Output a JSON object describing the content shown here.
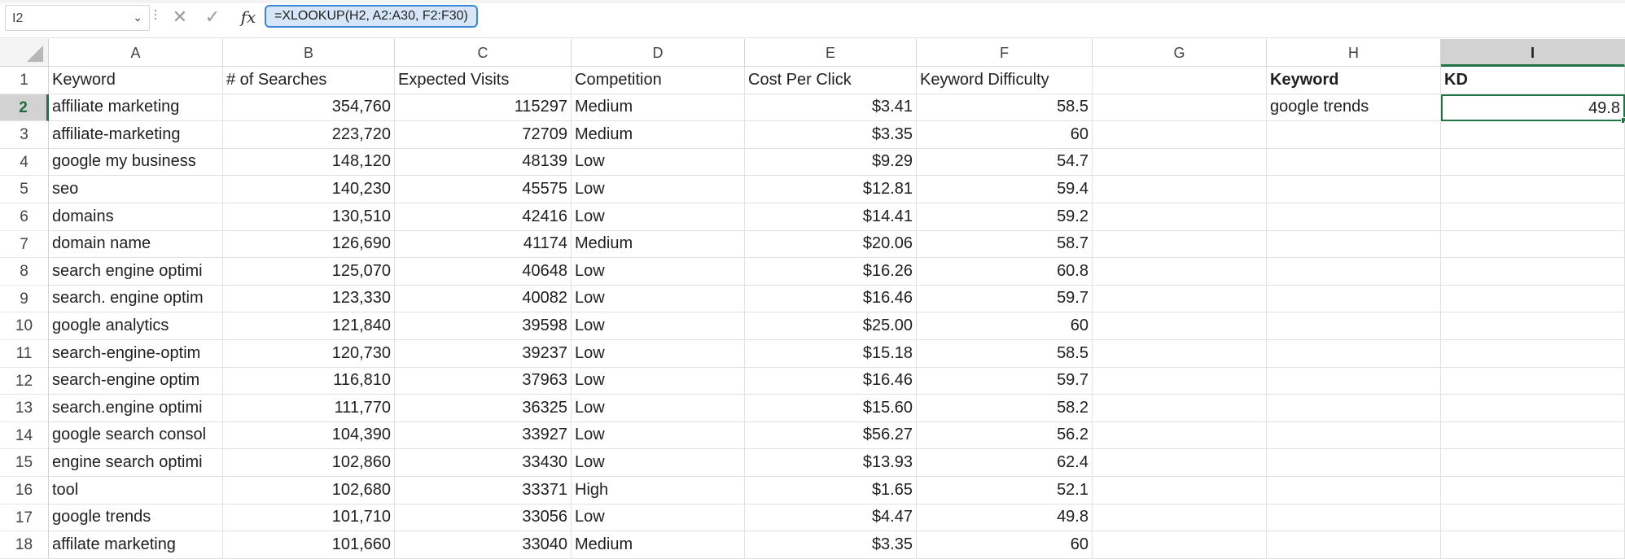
{
  "namebox": {
    "value": "I2"
  },
  "formula_bar": {
    "fx_label": "fx",
    "formula": "=XLOOKUP(H2, A2:A30, F2:F30)"
  },
  "columns": [
    "A",
    "B",
    "C",
    "D",
    "E",
    "F",
    "G",
    "H",
    "I"
  ],
  "selected_cell": {
    "column": "I",
    "row": 2
  },
  "rows": [
    {
      "n": "1",
      "cells": [
        "Keyword",
        "# of Searches",
        "Expected Visits",
        "Competition",
        "Cost Per Click",
        "Keyword Difficulty",
        "",
        "Keyword",
        "KD"
      ]
    },
    {
      "n": "2",
      "cells": [
        "affiliate marketing",
        "354,760",
        "115297",
        "Medium",
        "$3.41",
        "58.5",
        "",
        "google trends",
        "49.8"
      ]
    },
    {
      "n": "3",
      "cells": [
        "affiliate-marketing",
        "223,720",
        "72709",
        "Medium",
        "$3.35",
        "60",
        "",
        "",
        ""
      ]
    },
    {
      "n": "4",
      "cells": [
        "google my business",
        "148,120",
        "48139",
        "Low",
        "$9.29",
        "54.7",
        "",
        "",
        ""
      ]
    },
    {
      "n": "5",
      "cells": [
        "seo",
        "140,230",
        "45575",
        "Low",
        "$12.81",
        "59.4",
        "",
        "",
        ""
      ]
    },
    {
      "n": "6",
      "cells": [
        "domains",
        "130,510",
        "42416",
        "Low",
        "$14.41",
        "59.2",
        "",
        "",
        ""
      ]
    },
    {
      "n": "7",
      "cells": [
        "domain name",
        "126,690",
        "41174",
        "Medium",
        "$20.06",
        "58.7",
        "",
        "",
        ""
      ]
    },
    {
      "n": "8",
      "cells": [
        "search engine optimi",
        "125,070",
        "40648",
        "Low",
        "$16.26",
        "60.8",
        "",
        "",
        ""
      ]
    },
    {
      "n": "9",
      "cells": [
        "search. engine optim",
        "123,330",
        "40082",
        "Low",
        "$16.46",
        "59.7",
        "",
        "",
        ""
      ]
    },
    {
      "n": "10",
      "cells": [
        "google analytics",
        "121,840",
        "39598",
        "Low",
        "$25.00",
        "60",
        "",
        "",
        ""
      ]
    },
    {
      "n": "11",
      "cells": [
        "search-engine-optim",
        "120,730",
        "39237",
        "Low",
        "$15.18",
        "58.5",
        "",
        "",
        ""
      ]
    },
    {
      "n": "12",
      "cells": [
        "search-engine optim",
        "116,810",
        "37963",
        "Low",
        "$16.46",
        "59.7",
        "",
        "",
        ""
      ]
    },
    {
      "n": "13",
      "cells": [
        "search.engine optimi",
        "111,770",
        "36325",
        "Low",
        "$15.60",
        "58.2",
        "",
        "",
        ""
      ]
    },
    {
      "n": "14",
      "cells": [
        "google search consol",
        "104,390",
        "33927",
        "Low",
        "$56.27",
        "56.2",
        "",
        "",
        ""
      ]
    },
    {
      "n": "15",
      "cells": [
        "engine search optimi",
        "102,860",
        "33430",
        "Low",
        "$13.93",
        "62.4",
        "",
        "",
        ""
      ]
    },
    {
      "n": "16",
      "cells": [
        "tool",
        "102,680",
        "33371",
        "High",
        "$1.65",
        "52.1",
        "",
        "",
        ""
      ]
    },
    {
      "n": "17",
      "cells": [
        "google trends",
        "101,710",
        "33056",
        "Low",
        "$4.47",
        "49.8",
        "",
        "",
        ""
      ]
    },
    {
      "n": "18",
      "cells": [
        "affilate marketing",
        "101,660",
        "33040",
        "Medium",
        "$3.35",
        "60",
        "",
        "",
        ""
      ]
    }
  ]
}
